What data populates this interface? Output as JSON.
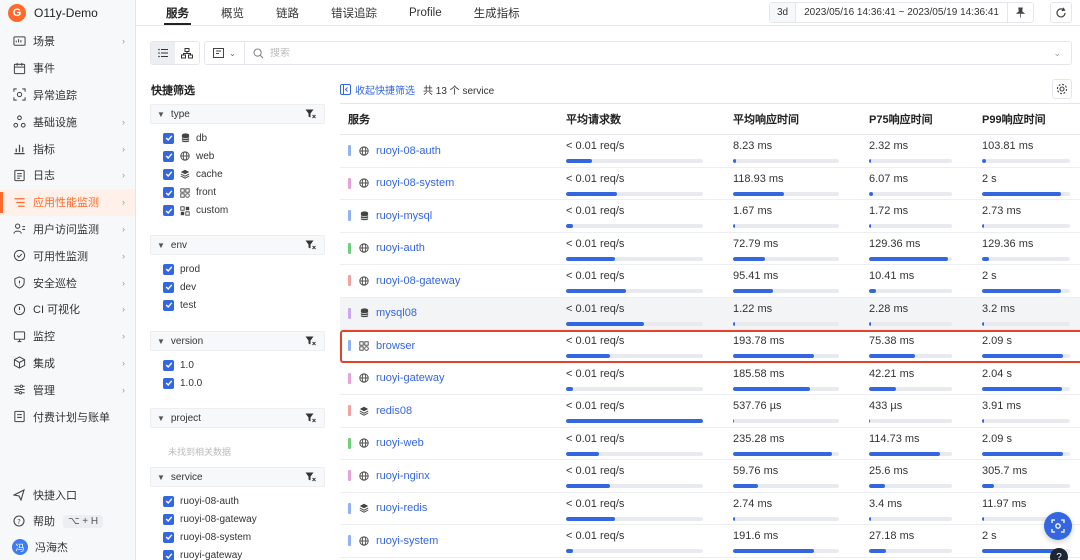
{
  "brand": {
    "logo_letter": "G",
    "name": "O11y-Demo"
  },
  "sidebar": {
    "items": [
      {
        "label": "场景",
        "icon": "dashboard-icon",
        "arrow": true
      },
      {
        "label": "事件",
        "icon": "calendar-icon",
        "arrow": false
      },
      {
        "label": "异常追踪",
        "icon": "bug-scan-icon",
        "arrow": false
      },
      {
        "label": "基础设施",
        "icon": "nodes-icon",
        "arrow": true
      },
      {
        "label": "指标",
        "icon": "bar-chart-icon",
        "arrow": true
      },
      {
        "label": "日志",
        "icon": "log-file-icon",
        "arrow": true
      },
      {
        "label": "应用性能监测",
        "icon": "apm-icon",
        "arrow": true,
        "active": true
      },
      {
        "label": "用户访问监测",
        "icon": "user-monitor-icon",
        "arrow": true
      },
      {
        "label": "可用性监测",
        "icon": "availability-icon",
        "arrow": true
      },
      {
        "label": "安全巡检",
        "icon": "shield-icon",
        "arrow": true
      },
      {
        "label": "CI 可视化",
        "icon": "ci-icon",
        "arrow": true
      },
      {
        "label": "监控",
        "icon": "monitor-icon",
        "arrow": true
      },
      {
        "label": "集成",
        "icon": "cube-icon",
        "arrow": true
      },
      {
        "label": "管理",
        "icon": "sliders-icon",
        "arrow": true
      },
      {
        "label": "付费计划与账单",
        "icon": "billing-icon",
        "arrow": false
      }
    ],
    "bottom": {
      "quick_entry": "快捷入口",
      "help": "帮助",
      "help_shortcut": "⌥ + H",
      "user_avatar": "冯",
      "user_name": "冯海杰"
    }
  },
  "tabs": [
    "服务",
    "概览",
    "链路",
    "错误追踪",
    "Profile",
    "生成指标"
  ],
  "active_tab": 0,
  "time": {
    "quick": "3d",
    "range": "2023/05/16 14:36:41 ~ 2023/05/19 14:36:41"
  },
  "search": {
    "placeholder": "搜索"
  },
  "filter": {
    "title": "快捷筛选",
    "groups": [
      {
        "name": "type",
        "items": [
          {
            "label": "db",
            "icon": "database-icon"
          },
          {
            "label": "web",
            "icon": "globe-icon"
          },
          {
            "label": "cache",
            "icon": "cache-icon"
          },
          {
            "label": "front",
            "icon": "front-icon"
          },
          {
            "label": "custom",
            "icon": "custom-icon"
          }
        ]
      },
      {
        "name": "env",
        "items": [
          {
            "label": "prod"
          },
          {
            "label": "dev"
          },
          {
            "label": "test"
          }
        ]
      },
      {
        "name": "version",
        "items": [
          {
            "label": "1.0"
          },
          {
            "label": "1.0.0"
          }
        ]
      },
      {
        "name": "project",
        "items": [],
        "empty_text": "未找到相关数据"
      },
      {
        "name": "service",
        "items": [
          {
            "label": "ruoyi-08-auth"
          },
          {
            "label": "ruoyi-08-gateway"
          },
          {
            "label": "ruoyi-08-system"
          },
          {
            "label": "ruoyi-gateway"
          }
        ]
      }
    ]
  },
  "main": {
    "collapse_label": "收起快捷筛选",
    "total_text": "共 13 个 service"
  },
  "table": {
    "columns": [
      "服务",
      "平均请求数",
      "平均响应时间",
      "P75响应时间",
      "P99响应时间"
    ],
    "rows": [
      {
        "name": "ruoyi-08-auth",
        "type": "web",
        "color": "#8fb4f5",
        "req": "< 0.01 req/s",
        "req_pct": 19,
        "avg": "8.23 ms",
        "avg_pct": 3,
        "p75": "2.32 ms",
        "p75_pct": 3,
        "p99": "103.81 ms",
        "p99_pct": 5
      },
      {
        "name": "ruoyi-08-system",
        "type": "web",
        "color": "#e6a3d8",
        "req": "< 0.01 req/s",
        "req_pct": 37,
        "avg": "118.93 ms",
        "avg_pct": 48,
        "p75": "6.07 ms",
        "p75_pct": 5,
        "p99": "2 s",
        "p99_pct": 90
      },
      {
        "name": "ruoyi-mysql",
        "type": "db",
        "color": "#8fb4f5",
        "req": "< 0.01 req/s",
        "req_pct": 5,
        "avg": "1.67 ms",
        "avg_pct": 2,
        "p75": "1.72 ms",
        "p75_pct": 3,
        "p99": "2.73 ms",
        "p99_pct": 2
      },
      {
        "name": "ruoyi-auth",
        "type": "web",
        "color": "#6fcf7a",
        "req": "< 0.01 req/s",
        "req_pct": 36,
        "avg": "72.79 ms",
        "avg_pct": 30,
        "p75": "129.36 ms",
        "p75_pct": 95,
        "p99": "129.36 ms",
        "p99_pct": 8
      },
      {
        "name": "ruoyi-08-gateway",
        "type": "web",
        "color": "#f2a1a1",
        "req": "< 0.01 req/s",
        "req_pct": 44,
        "avg": "95.41 ms",
        "avg_pct": 38,
        "p75": "10.41 ms",
        "p75_pct": 8,
        "p99": "2 s",
        "p99_pct": 90
      },
      {
        "name": "mysql08",
        "type": "db",
        "color": "#c8a8f0",
        "req": "< 0.01 req/s",
        "req_pct": 57,
        "avg": "1.22 ms",
        "avg_pct": 2,
        "p75": "2.28 ms",
        "p75_pct": 3,
        "p99": "3.2 ms",
        "p99_pct": 2,
        "hover": true
      },
      {
        "name": "browser",
        "type": "front",
        "color": "#8fb4f5",
        "req": "< 0.01 req/s",
        "req_pct": 32,
        "avg": "193.78 ms",
        "avg_pct": 76,
        "p75": "75.38 ms",
        "p75_pct": 56,
        "p99": "2.09 s",
        "p99_pct": 92,
        "selected": true
      },
      {
        "name": "ruoyi-gateway",
        "type": "web",
        "color": "#e6a3d8",
        "req": "< 0.01 req/s",
        "req_pct": 5,
        "avg": "185.58 ms",
        "avg_pct": 73,
        "p75": "42.21 ms",
        "p75_pct": 32,
        "p99": "2.04 s",
        "p99_pct": 91
      },
      {
        "name": "redis08",
        "type": "cache",
        "color": "#f2a1a1",
        "req": "< 0.01 req/s",
        "req_pct": 100,
        "avg": "537.76 µs",
        "avg_pct": 1,
        "p75": "433 µs",
        "p75_pct": 1,
        "p99": "3.91 ms",
        "p99_pct": 2
      },
      {
        "name": "ruoyi-web",
        "type": "web",
        "color": "#6fcf7a",
        "req": "< 0.01 req/s",
        "req_pct": 24,
        "avg": "235.28 ms",
        "avg_pct": 93,
        "p75": "114.73 ms",
        "p75_pct": 86,
        "p99": "2.09 s",
        "p99_pct": 92
      },
      {
        "name": "ruoyi-nginx",
        "type": "web",
        "color": "#e6a3d8",
        "req": "< 0.01 req/s",
        "req_pct": 32,
        "avg": "59.76 ms",
        "avg_pct": 24,
        "p75": "25.6 ms",
        "p75_pct": 19,
        "p99": "305.7 ms",
        "p99_pct": 14
      },
      {
        "name": "ruoyi-redis",
        "type": "cache",
        "color": "#8fb4f5",
        "req": "< 0.01 req/s",
        "req_pct": 36,
        "avg": "2.74 ms",
        "avg_pct": 2,
        "p75": "3.4 ms",
        "p75_pct": 3,
        "p99": "11.97 ms",
        "p99_pct": 2
      },
      {
        "name": "ruoyi-system",
        "type": "web",
        "color": "#8fb4f5",
        "req": "< 0.01 req/s",
        "req_pct": 5,
        "avg": "191.6 ms",
        "avg_pct": 76,
        "p75": "27.18 ms",
        "p75_pct": 20,
        "p99": "2 s",
        "p99_pct": 90
      }
    ]
  }
}
